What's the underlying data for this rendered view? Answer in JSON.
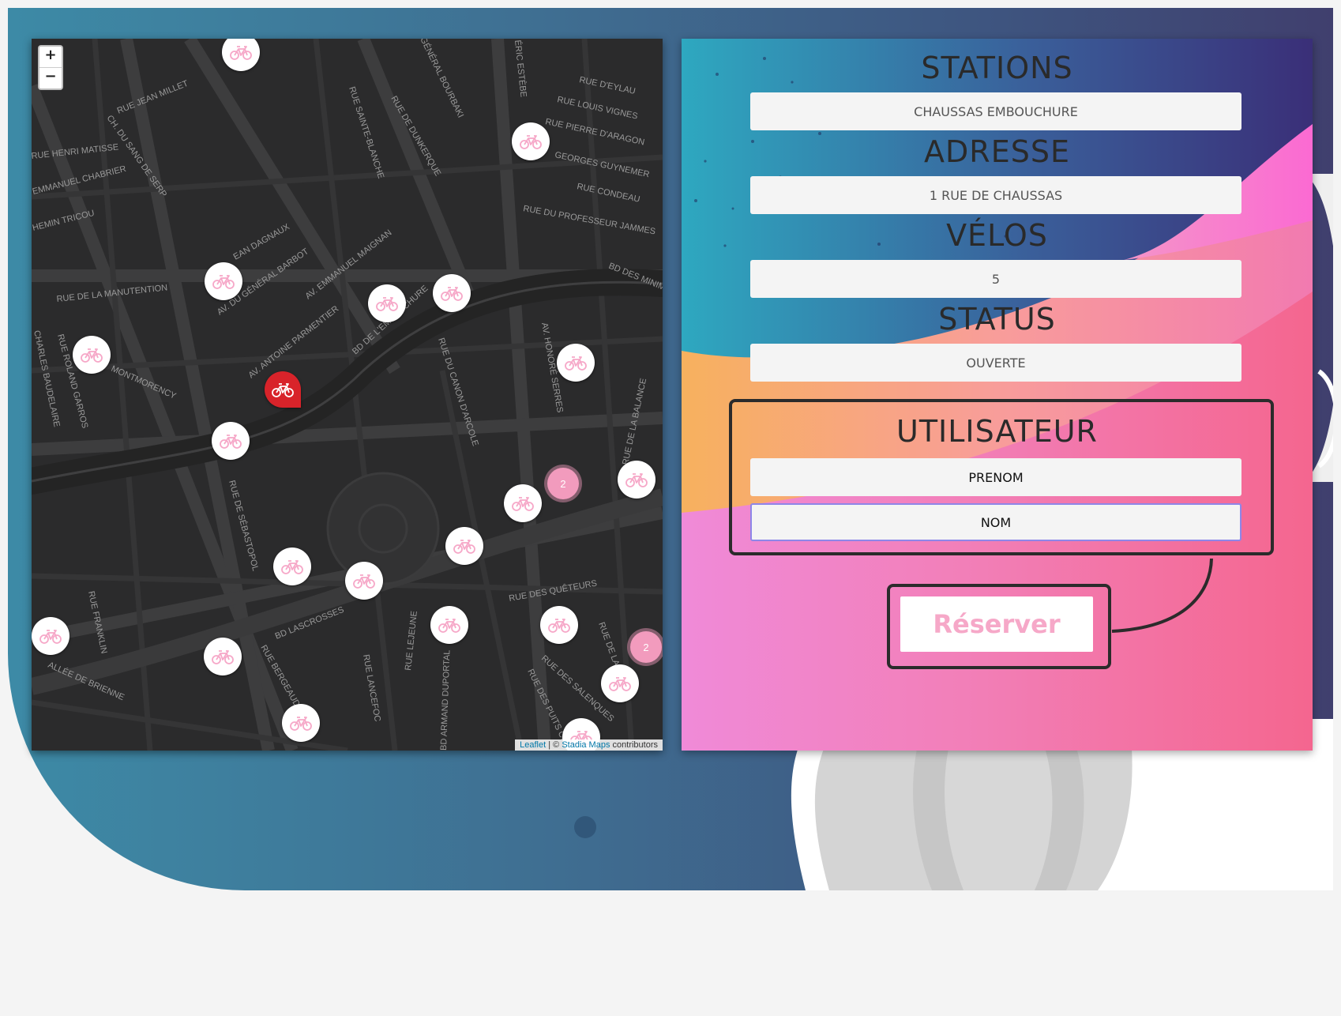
{
  "map": {
    "zoom_in": "+",
    "zoom_out": "−",
    "attribution": {
      "leaflet": "Leaflet",
      "sep": " | © ",
      "provider": "Stadia Maps",
      "tail": " contributors"
    },
    "streets": [
      "RUE JEAN MILLET",
      "CH. DU SANG DE SERP",
      "RUE HENRI MATISSE",
      "EMMANUEL CHABRIER",
      "HEMIN TRICOU",
      "RUE DE LA MANUTENTION",
      "AV. DU GÉNÉRAL BARBOT",
      "AV. EMMANUEL MAIGNAN",
      "AV. ANTOINE PARMENTIER",
      "BD DE L'EMBOUCHURE",
      "RUE ROLAND GARROS",
      "CHARLES BAUDELAIRE",
      "MONTMORENCY",
      "RUE SAINTE-BLANCHE",
      "RUE DE DUNKERQUE",
      "GÉNÉRAL BOURBAKI",
      "RUE D'EYLAU",
      "RUE LOUIS VIGNES",
      "RUE PIERRE D'ARAGON",
      "GEORGES GUYNEMER",
      "RUE CONDEAU",
      "RUE DU PROFESSEUR JAMMES",
      "BD DES MINIMES",
      "AV. HONORÉ SERRES",
      "RUE DU CANON D'ARCOLE",
      "RUE DE LA BALANCE",
      "RUE DE SÉBASTOPOL",
      "BD LASCROSSES",
      "RUE FRANKLIN",
      "ALLÉE DE BRIENNE",
      "RUE BERGEAUD",
      "RUE LANCEFOC",
      "RUE LEJEUNE",
      "BD ARMAND DUPORTAL",
      "RUE DES QUÊTEURS",
      "RUE DES SALENQUES",
      "RUE DES PUITS CREUSÉS",
      "RUE DE LA",
      "EAN DAGNAUX",
      "ÉRIC ESTÈBE"
    ],
    "clusters": [
      "2",
      "2"
    ]
  },
  "station": {
    "stations_label": "STATIONS",
    "station_name": "CHAUSSAS EMBOUCHURE",
    "address_label": "ADRESSE",
    "address": "1 RUE DE CHAUSSAS",
    "bikes_label": "VÉLOS",
    "bikes": "5",
    "status_label": "STATUS",
    "status": "OUVERTE"
  },
  "user": {
    "title": "UTILISATEUR",
    "firstname_value": "PRENOM",
    "lastname_value": "NOM"
  },
  "actions": {
    "reserve_label": "Réserver"
  },
  "colors": {
    "accent": "#f6a8c8",
    "marker_active": "#d8232a",
    "cluster": "#f29bbd"
  }
}
